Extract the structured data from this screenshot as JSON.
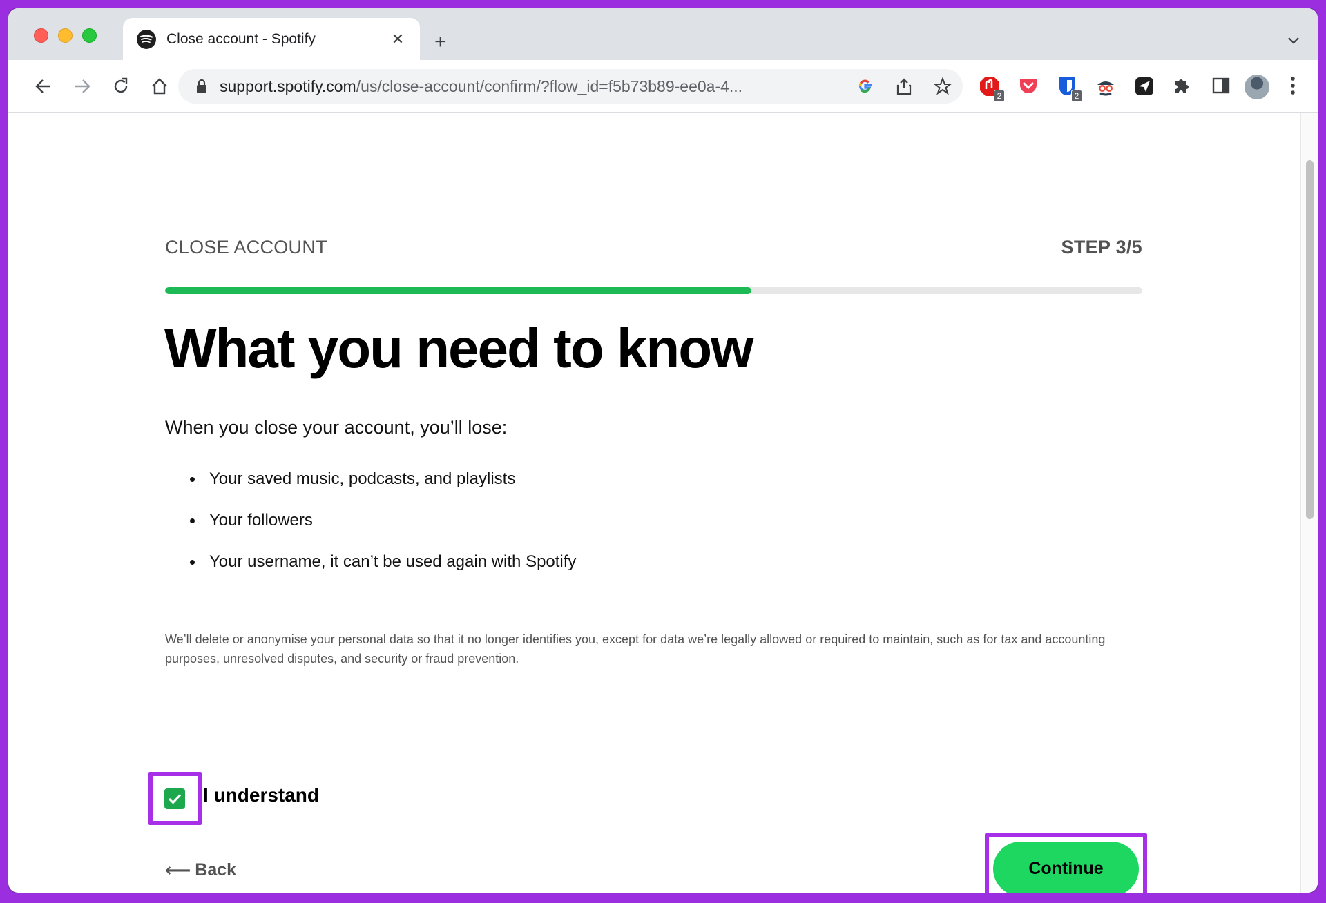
{
  "browser": {
    "tab_title": "Close account - Spotify",
    "url_host": "support.spotify.com",
    "url_path": "/us/close-account/confirm/?flow_id=f5b73b89-ee0a-4...",
    "extensions": [
      {
        "name": "adblock-extension-icon",
        "badge": "2"
      },
      {
        "name": "pocket-extension-icon",
        "badge": ""
      },
      {
        "name": "bitwarden-extension-icon",
        "badge": "2"
      },
      {
        "name": "spy-extension-icon",
        "badge": ""
      },
      {
        "name": "send-extension-icon",
        "badge": ""
      }
    ],
    "colors": {
      "accent": "#1db954",
      "highlight": "#a72fe8",
      "frame": "#9b2fe0"
    }
  },
  "page": {
    "section_label": "CLOSE ACCOUNT",
    "step_label": "STEP 3/5",
    "progress": 0.6,
    "headline": "What you need to know",
    "lead": "When you close your account, you’ll lose:",
    "losses": [
      "Your saved music, podcasts, and playlists",
      "Your followers",
      "Your username, it can’t be used again with Spotify"
    ],
    "legal_text": "We’ll delete or anonymise your personal data so that it no longer identifies you, except for data we’re legally allowed or required to maintain, such as for tax and accounting purposes, unresolved disputes, and security or fraud prevention.",
    "checkbox_label": "I understand",
    "checkbox_checked": true,
    "back_label": "Back",
    "continue_label": "Continue"
  }
}
